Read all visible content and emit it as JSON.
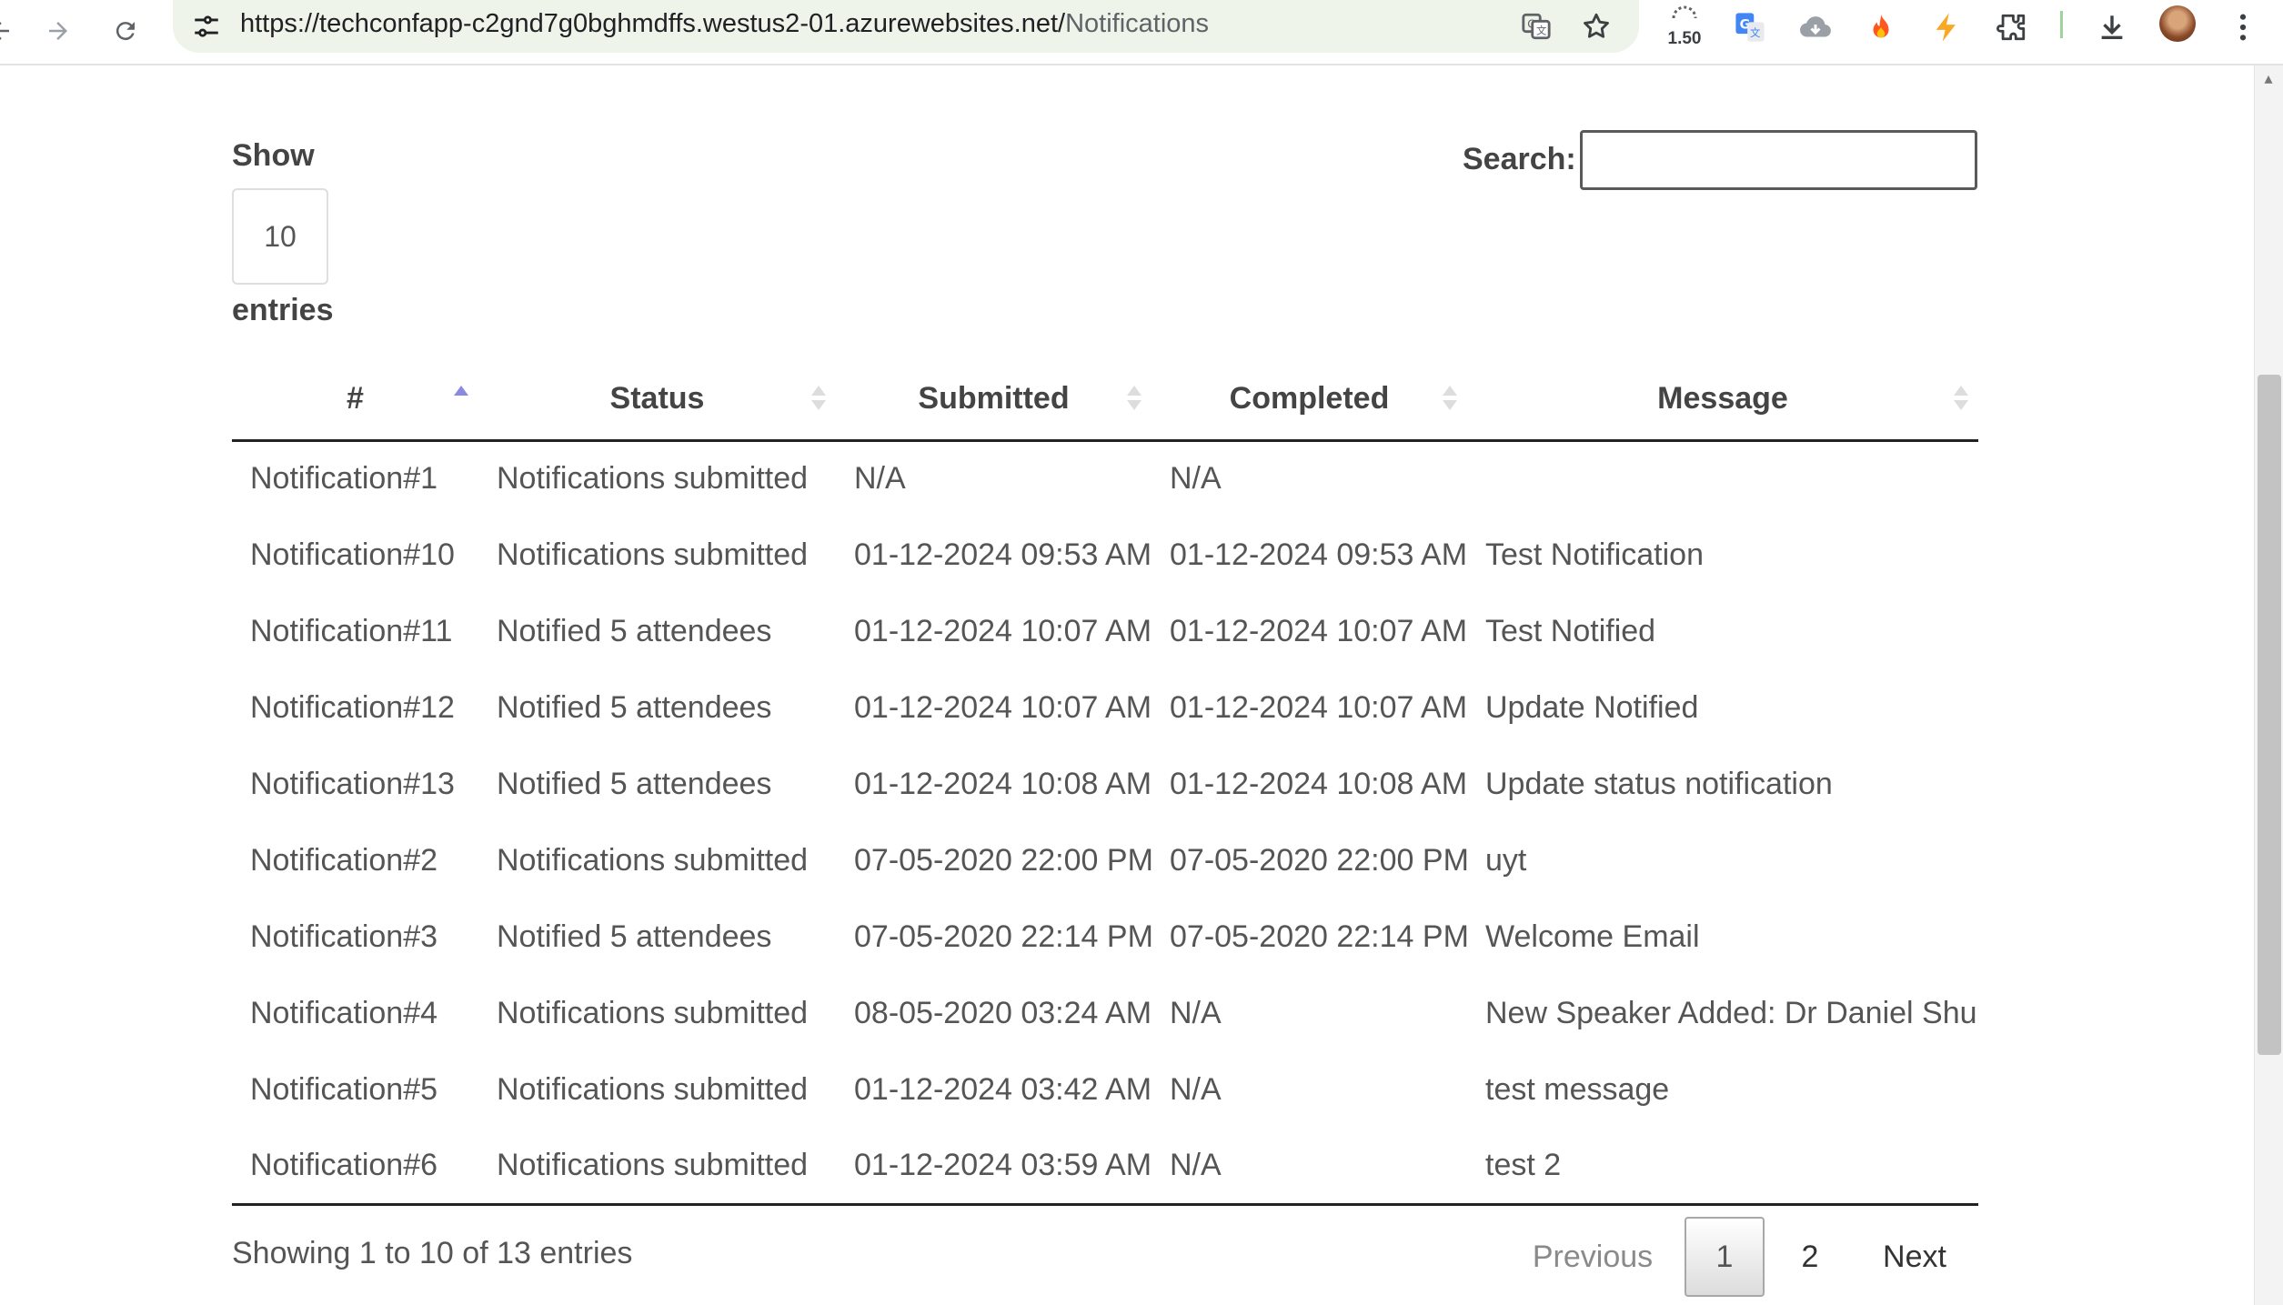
{
  "browser": {
    "url_host": "https://techconfapp-c2gnd7g0bghmdffs.westus2-01.azurewebsites.net/",
    "url_path": "Notifications",
    "zoom_level": "1.50",
    "icons": [
      "back-arrow-icon",
      "forward-arrow-icon",
      "reload-icon",
      "site-settings-icon",
      "translate-icon",
      "bookmark-star-icon",
      "zoom-icon",
      "google-translate-icon",
      "cloud-download-icon",
      "fire-extension-icon",
      "lightning-extension-icon",
      "extensions-puzzle-icon",
      "downloads-icon",
      "profile-avatar",
      "menu-dots-icon"
    ],
    "accent_color": "#eef4e9"
  },
  "controls": {
    "show_label": "Show",
    "page_length": "10",
    "entries_label": "entries",
    "search_label": "Search:",
    "search_value": ""
  },
  "table": {
    "columns": [
      "#",
      "Status",
      "Submitted",
      "Completed",
      "Message"
    ],
    "sorted_column": "#",
    "sort_direction": "ascending",
    "rows": [
      {
        "id": "Notification#1",
        "status": "Notifications submitted",
        "submitted": "N/A",
        "completed": "N/A",
        "message": ""
      },
      {
        "id": "Notification#10",
        "status": "Notifications submitted",
        "submitted": "01-12-2024 09:53 AM",
        "completed": "01-12-2024 09:53 AM",
        "message": "Test Notification"
      },
      {
        "id": "Notification#11",
        "status": "Notified 5 attendees",
        "submitted": "01-12-2024 10:07 AM",
        "completed": "01-12-2024 10:07 AM",
        "message": "Test Notified"
      },
      {
        "id": "Notification#12",
        "status": "Notified 5 attendees",
        "submitted": "01-12-2024 10:07 AM",
        "completed": "01-12-2024 10:07 AM",
        "message": "Update Notified"
      },
      {
        "id": "Notification#13",
        "status": "Notified 5 attendees",
        "submitted": "01-12-2024 10:08 AM",
        "completed": "01-12-2024 10:08 AM",
        "message": "Update status notification"
      },
      {
        "id": "Notification#2",
        "status": "Notifications submitted",
        "submitted": "07-05-2020 22:00 PM",
        "completed": "07-05-2020 22:00 PM",
        "message": "uyt"
      },
      {
        "id": "Notification#3",
        "status": "Notified 5 attendees",
        "submitted": "07-05-2020 22:14 PM",
        "completed": "07-05-2020 22:14 PM",
        "message": "Welcome Email"
      },
      {
        "id": "Notification#4",
        "status": "Notifications submitted",
        "submitted": "08-05-2020 03:24 AM",
        "completed": "N/A",
        "message": "New Speaker Added: Dr Daniel Shu"
      },
      {
        "id": "Notification#5",
        "status": "Notifications submitted",
        "submitted": "01-12-2024 03:42 AM",
        "completed": "N/A",
        "message": "test message"
      },
      {
        "id": "Notification#6",
        "status": "Notifications submitted",
        "submitted": "01-12-2024 03:59 AM",
        "completed": "N/A",
        "message": "test 2"
      }
    ]
  },
  "footer": {
    "info": "Showing 1 to 10 of 13 entries",
    "previous_label": "Previous",
    "pages": [
      "1",
      "2"
    ],
    "current_page": "1",
    "next_label": "Next"
  }
}
